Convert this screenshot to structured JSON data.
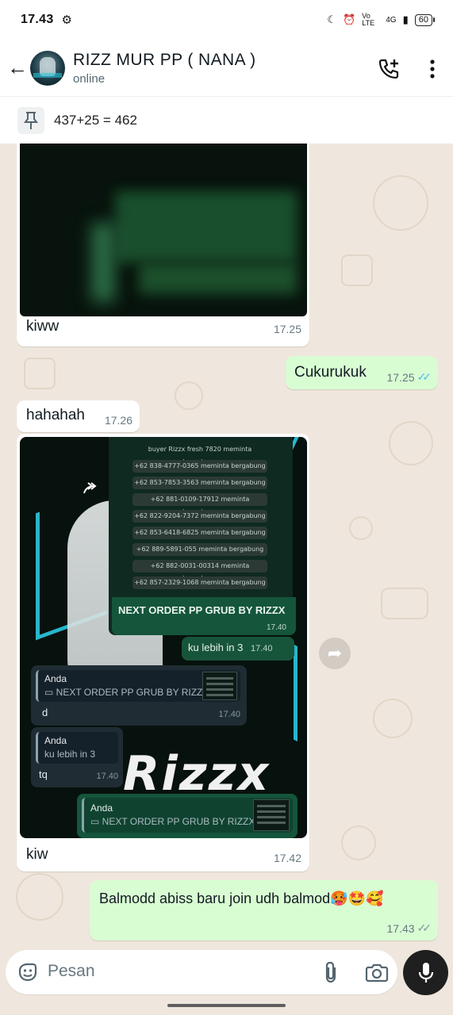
{
  "status_bar": {
    "time": "17.43",
    "network": "Vo LTE",
    "signal": "4G",
    "battery": "60"
  },
  "header": {
    "title": "RIZZ MUR PP ( NANA )",
    "subtitle": "online"
  },
  "pinned": {
    "text": "437+25 = 462"
  },
  "messages": [
    {
      "id": "m1",
      "direction": "in",
      "type": "image",
      "caption": "kiww",
      "time": "17.25"
    },
    {
      "id": "m2",
      "direction": "out",
      "type": "text",
      "text": "Cukurukuk",
      "time": "17.25",
      "status": "read"
    },
    {
      "id": "m3",
      "direction": "in",
      "type": "text",
      "text": "hahahah",
      "time": "17.26"
    },
    {
      "id": "m4",
      "direction": "in",
      "type": "image",
      "caption": "kiw",
      "time": "17.42"
    },
    {
      "id": "m5",
      "direction": "out",
      "type": "text",
      "text": "Balmodd abiss baru join udh balmod🥵🤩🥰",
      "time": "17.43",
      "status": "sent"
    }
  ],
  "screenshot_in_image": {
    "rows": [
      "buyer Rizzx fresh 7820 meminta bergabung",
      "+62 838-4777-0365 meminta bergabung",
      "+62 853-7853-3563 meminta bergabung",
      "+62 881-0109-17912 meminta bergabung",
      "+62 822-9204-7372 meminta bergabung",
      "+62 853-6418-6825 meminta bergabung",
      "+62 889-5891-055 meminta bergabung",
      "+62 882-0031-00314 meminta bergabung",
      "+62 857-2329-1068 meminta bergabung"
    ],
    "caption": "NEXT ORDER PP GRUB BY RIZZX",
    "caption_time": "17.40",
    "mini_text": "ku lebih in 3",
    "mini_time": "17.40",
    "reply1": {
      "who": "Anda",
      "quote": "NEXT ORDER PP GRUB BY RIZZX",
      "text": "d",
      "time": "17.40"
    },
    "reply2": {
      "who": "Anda",
      "quote": "ku lebih in 3",
      "text": "tq",
      "time": "17.40"
    },
    "reply3": {
      "who": "Anda",
      "quote": "NEXT ORDER PP GRUB BY RIZZX"
    },
    "logo_text": "Rizzx"
  },
  "input": {
    "placeholder": "Pesan"
  },
  "colors": {
    "outgoing_bubble": "#d9fdd3",
    "read_ticks": "#53bdeb",
    "chat_bg": "#efe7dd"
  }
}
